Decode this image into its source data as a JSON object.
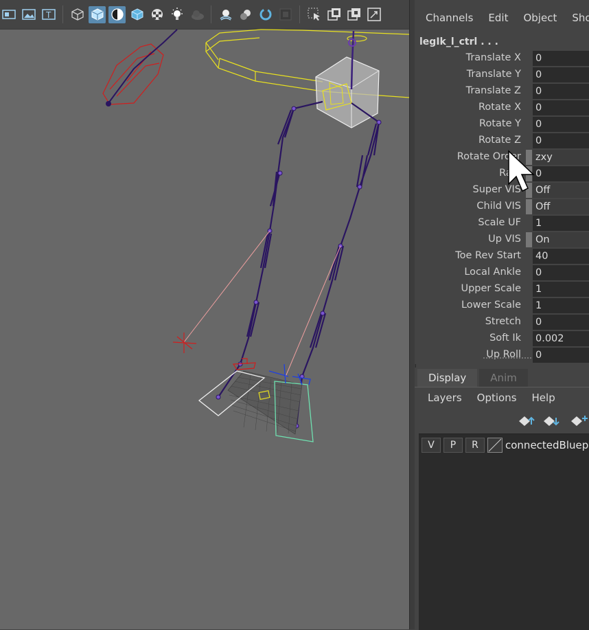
{
  "channel_box": {
    "menu": [
      "Channels",
      "Edit",
      "Object",
      "Sho"
    ],
    "object_name": "legIk_l_ctrl . . .",
    "attributes": [
      {
        "label": "Translate X",
        "value": "0"
      },
      {
        "label": "Translate Y",
        "value": "0"
      },
      {
        "label": "Translate Z",
        "value": "0"
      },
      {
        "label": "Rotate X",
        "value": "0"
      },
      {
        "label": "Rotate Y",
        "value": "0"
      },
      {
        "label": "Rotate Z",
        "value": "0"
      },
      {
        "label": "Rotate Order",
        "value": "zxy"
      },
      {
        "label": "Radi",
        "value": "0"
      },
      {
        "label": "Super VIS",
        "value": "Off"
      },
      {
        "label": "Child VIS",
        "value": "Off"
      },
      {
        "label": "Scale UF",
        "value": "1"
      },
      {
        "label": "Up VIS",
        "value": "On"
      },
      {
        "label": "Toe Rev Start",
        "value": "40"
      },
      {
        "label": "Local Ankle",
        "value": "0"
      },
      {
        "label": "Upper Scale",
        "value": "1"
      },
      {
        "label": "Lower Scale",
        "value": "1"
      },
      {
        "label": "Stretch",
        "value": "0"
      },
      {
        "label": "Soft Ik",
        "value": "0.002"
      },
      {
        "label": "Up Roll",
        "value": "0"
      }
    ]
  },
  "layer_editor": {
    "tabs": [
      "Display",
      "Anim"
    ],
    "menu": [
      "Layers",
      "Options",
      "Help"
    ],
    "layer": {
      "v": "V",
      "p": "P",
      "r": "R",
      "name": "connectedBluepri"
    }
  },
  "colors": {
    "viewport_bg": "#686868",
    "panel_bg": "#444444",
    "field_bg": "#2b2b2b",
    "toolbar_active": "#5a8bb0",
    "joint": "#2a1560",
    "selection_yellow": "#e8e020"
  },
  "toolbar_icons": [
    "camera-attributes-icon",
    "image-plane-icon",
    "text-icon",
    "wireframe-cube-icon",
    "smooth-shade-cube-icon",
    "shade-wire-icon",
    "xray-cube-icon",
    "checker-icon",
    "light-bulb-icon",
    "shadow-icon",
    "ao-icon",
    "motion-blur-icon",
    "aa-icon",
    "isolate-icon",
    "select-camera-icon",
    "frame-all-icon",
    "frame-selected-icon",
    "resolution-gate-icon"
  ]
}
